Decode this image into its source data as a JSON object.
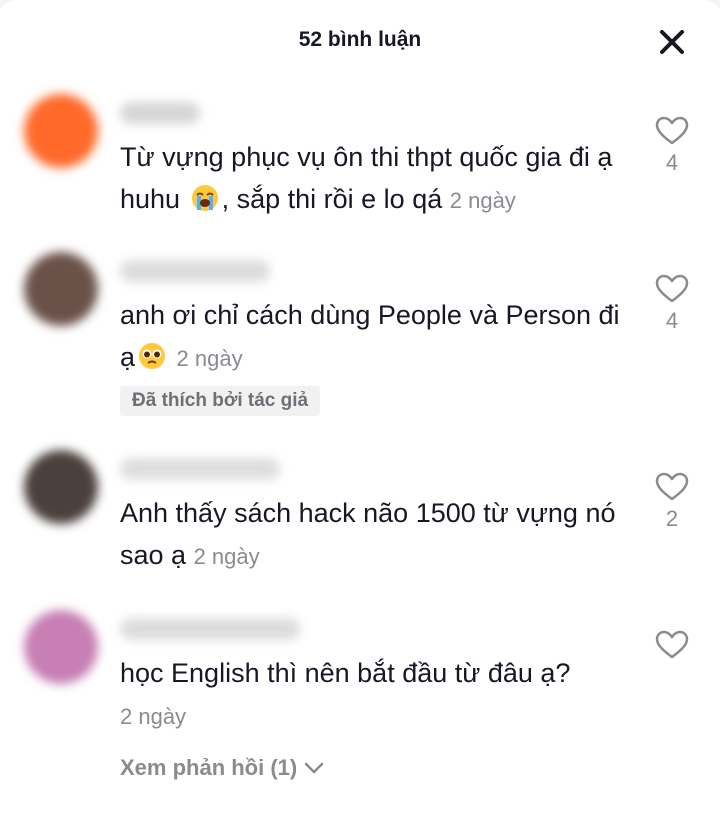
{
  "header": {
    "title": "52 bình luận",
    "close_icon": "close-icon"
  },
  "comments": [
    {
      "text": "Từ vựng phục vụ ôn thi thpt quốc gia đi ạ huhu",
      "emoji": "loudly-crying-face",
      "text_after_emoji": ", sắp thi rồi e lo qá",
      "time": "2 ngày",
      "likes": "4",
      "avatar_color": "#ff6a2b"
    },
    {
      "text": "anh ơi chỉ cách dùng People và Person đi ạ",
      "emoji": "pleading-face",
      "time": "2 ngày",
      "likes": "4",
      "badge": "Đã thích bởi tác giả",
      "avatar_color": "#6b5249"
    },
    {
      "text": "Anh thấy sách hack não 1500 từ vựng nó sao ạ",
      "time": "2 ngày",
      "likes": "2",
      "avatar_color": "#4a403c"
    },
    {
      "text": "học English thì nên bắt đầu từ đâu ạ?",
      "time": "2 ngày",
      "likes": "",
      "avatar_color": "#c77fb4"
    }
  ],
  "replies": {
    "label": "Xem phản hồi (1)",
    "icon": "chevron-down-icon"
  },
  "colors": {
    "text": "#161823",
    "muted": "#8a8b91",
    "badge_bg": "#f1f1f2"
  }
}
